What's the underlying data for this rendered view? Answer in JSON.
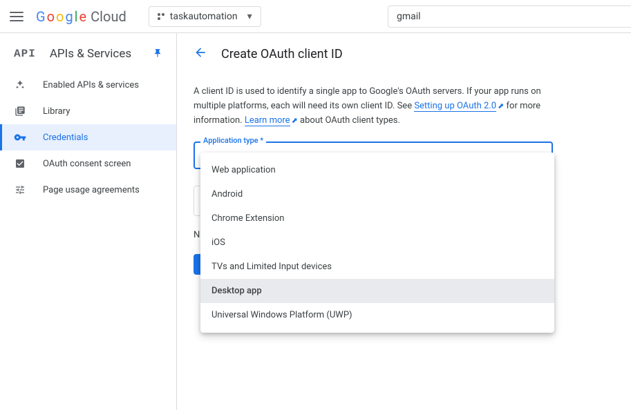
{
  "header": {
    "logo_text": "Google Cloud",
    "project_name": "taskautomation",
    "search_value": "gmail"
  },
  "sidebar": {
    "api_badge": "API",
    "title": "APIs & Services",
    "items": [
      {
        "label": "Enabled APIs & services",
        "icon": "diamond"
      },
      {
        "label": "Library",
        "icon": "library"
      },
      {
        "label": "Credentials",
        "icon": "key",
        "active": true
      },
      {
        "label": "OAuth consent screen",
        "icon": "consent"
      },
      {
        "label": "Page usage agreements",
        "icon": "agreements"
      }
    ]
  },
  "main": {
    "title": "Create OAuth client ID",
    "description_part1": "A client ID is used to identify a single app to Google's OAuth servers. If your app runs on multiple platforms, each will need its own client ID. See ",
    "link1": "Setting up OAuth 2.0",
    "description_part2": " for more information. ",
    "link2": "Learn more",
    "description_part3": " about OAuth client types.",
    "field_label": "Application type *",
    "note_prefix": "N",
    "dropdown_options": [
      {
        "label": "Web application"
      },
      {
        "label": "Android"
      },
      {
        "label": "Chrome Extension"
      },
      {
        "label": "iOS"
      },
      {
        "label": "TVs and Limited Input devices"
      },
      {
        "label": "Desktop app",
        "highlighted": true
      },
      {
        "label": "Universal Windows Platform (UWP)"
      }
    ]
  }
}
